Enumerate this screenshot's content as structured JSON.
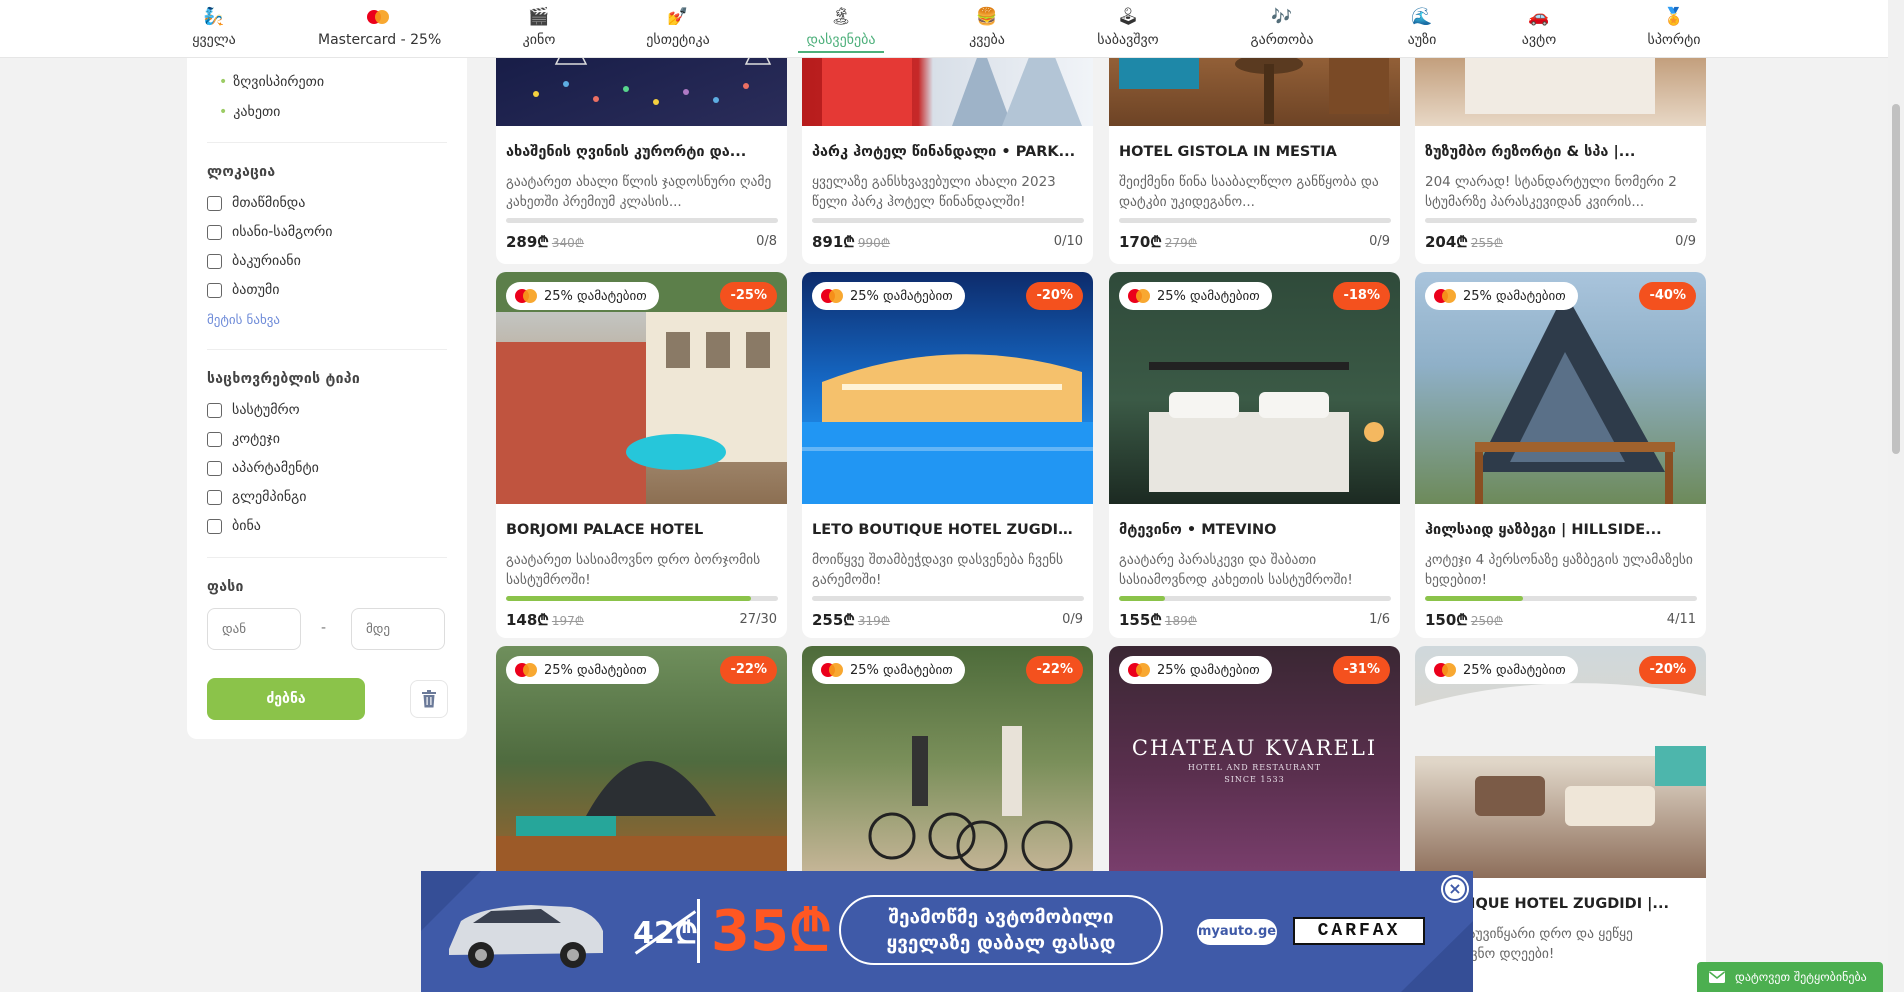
{
  "nav": [
    {
      "icon": "🧞",
      "label": "ყველა"
    },
    {
      "icon": "mastercard",
      "label": "Mastercard - 25%"
    },
    {
      "icon": "🎬",
      "label": "კინო"
    },
    {
      "icon": "💅",
      "label": "ესთეტიკა"
    },
    {
      "icon": "🏝",
      "label": "დასვენება",
      "active": true
    },
    {
      "icon": "🍔",
      "label": "კვება"
    },
    {
      "icon": "🕹",
      "label": "საბავშვო"
    },
    {
      "icon": "🎶",
      "label": "გართობა"
    },
    {
      "icon": "🌊",
      "label": "აუზი"
    },
    {
      "icon": "🚗",
      "label": "ავტო"
    },
    {
      "icon": "🏅",
      "label": "სპორტი"
    }
  ],
  "sidebar": {
    "regions": [
      "ზღვისპირეთი",
      "კახეთი"
    ],
    "location_title": "ლოკაცია",
    "locations": [
      "მთაწმინდა",
      "ისანი-სამგორი",
      "ბაკურიანი",
      "ბათუმი"
    ],
    "see_more": "მეტის ნახვა",
    "type_title": "საცხოვრებლის ტიპი",
    "types": [
      "სასტუმრო",
      "კოტეჯი",
      "აპარტამენტი",
      "გლემპინგი",
      "ბინა"
    ],
    "price_title": "ფასი",
    "price_from_placeholder": "დან",
    "price_to_placeholder": "მდე",
    "price_dash": "-",
    "search_label": "ძებნა"
  },
  "mc_badge": "25% დამატებით",
  "cards": [
    {
      "title": "ახაშენის ღვინის კურორტი და...",
      "desc": "გაატარეთ ახალი წლის ჯადოსნური ღამე კახეთში პრემიუმ კლასის...",
      "price": "289₾",
      "old": "340₾",
      "sold": "0/8",
      "progress": 0
    },
    {
      "title": "პარკ ჰოტელ წინანდალი • PARK...",
      "desc": "ყველაზე განსხვავებული ახალი 2023 წელი პარკ ჰოტელ წინანდალში!",
      "price": "891₾",
      "old": "990₾",
      "sold": "0/10",
      "progress": 0
    },
    {
      "title": "HOTEL GISTOLA IN MESTIA",
      "desc": "შეიქმენი წინა სააბალწლო განწყობა და დატკბი უკიდეგანო...",
      "price": "170₾",
      "old": "279₾",
      "sold": "0/9",
      "progress": 0
    },
    {
      "title": "ზუზუმბო რეზორტი & სპა |...",
      "desc": "204 ლარად! სტანდარტული ნომერი 2 სტუმარზე პარასკევიდან კვირის...",
      "price": "204₾",
      "old": "255₾",
      "sold": "0/9",
      "progress": 0
    },
    {
      "title": "BORJOMI PALACE HOTEL",
      "desc": "გაატარეთ სასიამოვნო დრო ბორჯომის სასტუმროში!",
      "price": "148₾",
      "old": "197₾",
      "sold": "27/30",
      "progress": 0.9,
      "discount": "-25%"
    },
    {
      "title": "LETO BOUTIQUE HOTEL ZUGDIDI |...",
      "desc": "მოიწყვე შთამბეჭდავი დასვენება ჩვენს გარემოში!",
      "price": "255₾",
      "old": "319₾",
      "sold": "0/9",
      "progress": 0,
      "discount": "-20%"
    },
    {
      "title": "მტევინო • MTEVINO",
      "desc": "გაატარე პარასკევი და შაბათი სასიამოვნოდ კახეთის სასტუმროში!",
      "price": "155₾",
      "old": "189₾",
      "sold": "1/6",
      "progress": 0.17,
      "discount": "-18%"
    },
    {
      "title": "ჰილსაიდ ყაზბეგი | HILLSIDE...",
      "desc": "კოტეჯი 4 პერსონაზე ყაზბეგის ულამაზესი ხედებით!",
      "price": "150₾",
      "old": "250₾",
      "sold": "4/11",
      "progress": 0.36,
      "discount": "-40%"
    },
    {
      "discount": "-22%"
    },
    {
      "discount": "-22%"
    },
    {
      "discount": "-31%",
      "overlay_title": "CHATEAU KVARELI",
      "overlay_sub": "HOTEL AND RESTAURANT",
      "overlay_since": "SINCE 1533"
    },
    {
      "title": "BOUTIQUE HOTEL ZUGDIDI |...",
      "desc": "ბრო დაუვიწყარი დრო და ყეწყე უსიამოვნო დღეები!",
      "discount": "-20%"
    }
  ],
  "ad": {
    "old_price": "42₾",
    "new_price": "35₾",
    "line1": "შეამოწმე ავტომობილი",
    "line2": "ყველაზე დაბალ ფასად",
    "myauto": "myauto.ge",
    "carfax": "CARFAX",
    "close": "×"
  },
  "feedback": "დატოვეთ შეტყობინება"
}
